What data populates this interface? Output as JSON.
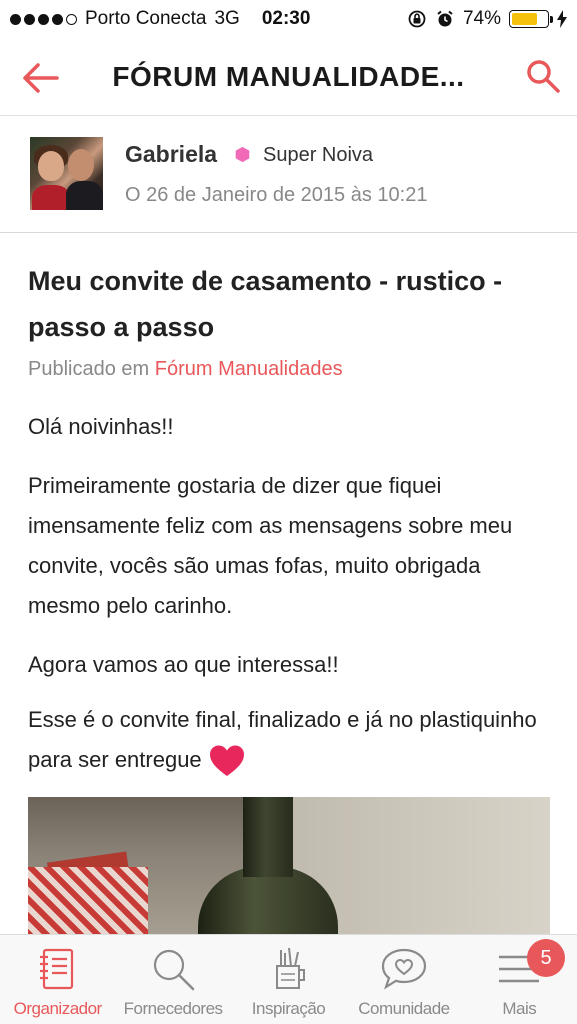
{
  "status_bar": {
    "carrier": "Porto Conecta",
    "network": "3G",
    "time": "02:30",
    "battery_percent": "74%",
    "battery_level": 0.74,
    "battery_color": "#f4c20d"
  },
  "nav": {
    "title": "FÓRUM MANUALIDADE...",
    "back_icon": "back-arrow-icon",
    "search_icon": "search-icon",
    "accent_color": "#e8585a"
  },
  "author": {
    "name": "Gabriela",
    "rank": "Super Noiva",
    "rank_badge_color": "#f06ab8",
    "date": "O 26 de Janeiro de 2015 às 10:21"
  },
  "post": {
    "title": "Meu convite de casamento - rustico - passo a passo",
    "meta_prefix": "Publicado em",
    "forum_name": "Fórum Manualidades",
    "paragraphs": [
      "Olá noivinhas!!",
      "Primeiramente gostaria de dizer que fiquei imensamente feliz com as mensagens sobre meu convite, vocês são umas fofas, muito obrigada mesmo pelo carinho.",
      "Agora vamos ao que interessa!!",
      "Esse é o convite final, finalizado e já no plastiquinho para ser entregue"
    ],
    "heart_color": "#e8275c"
  },
  "tabs": [
    {
      "label": "Organizador",
      "icon": "notebook-icon",
      "active": true
    },
    {
      "label": "Fornecedores",
      "icon": "magnifier-icon",
      "active": false
    },
    {
      "label": "Inspiração",
      "icon": "craft-cup-icon",
      "active": false
    },
    {
      "label": "Comunidade",
      "icon": "chat-heart-icon",
      "active": false
    },
    {
      "label": "Mais",
      "icon": "menu-icon",
      "active": false,
      "badge": "5"
    }
  ]
}
